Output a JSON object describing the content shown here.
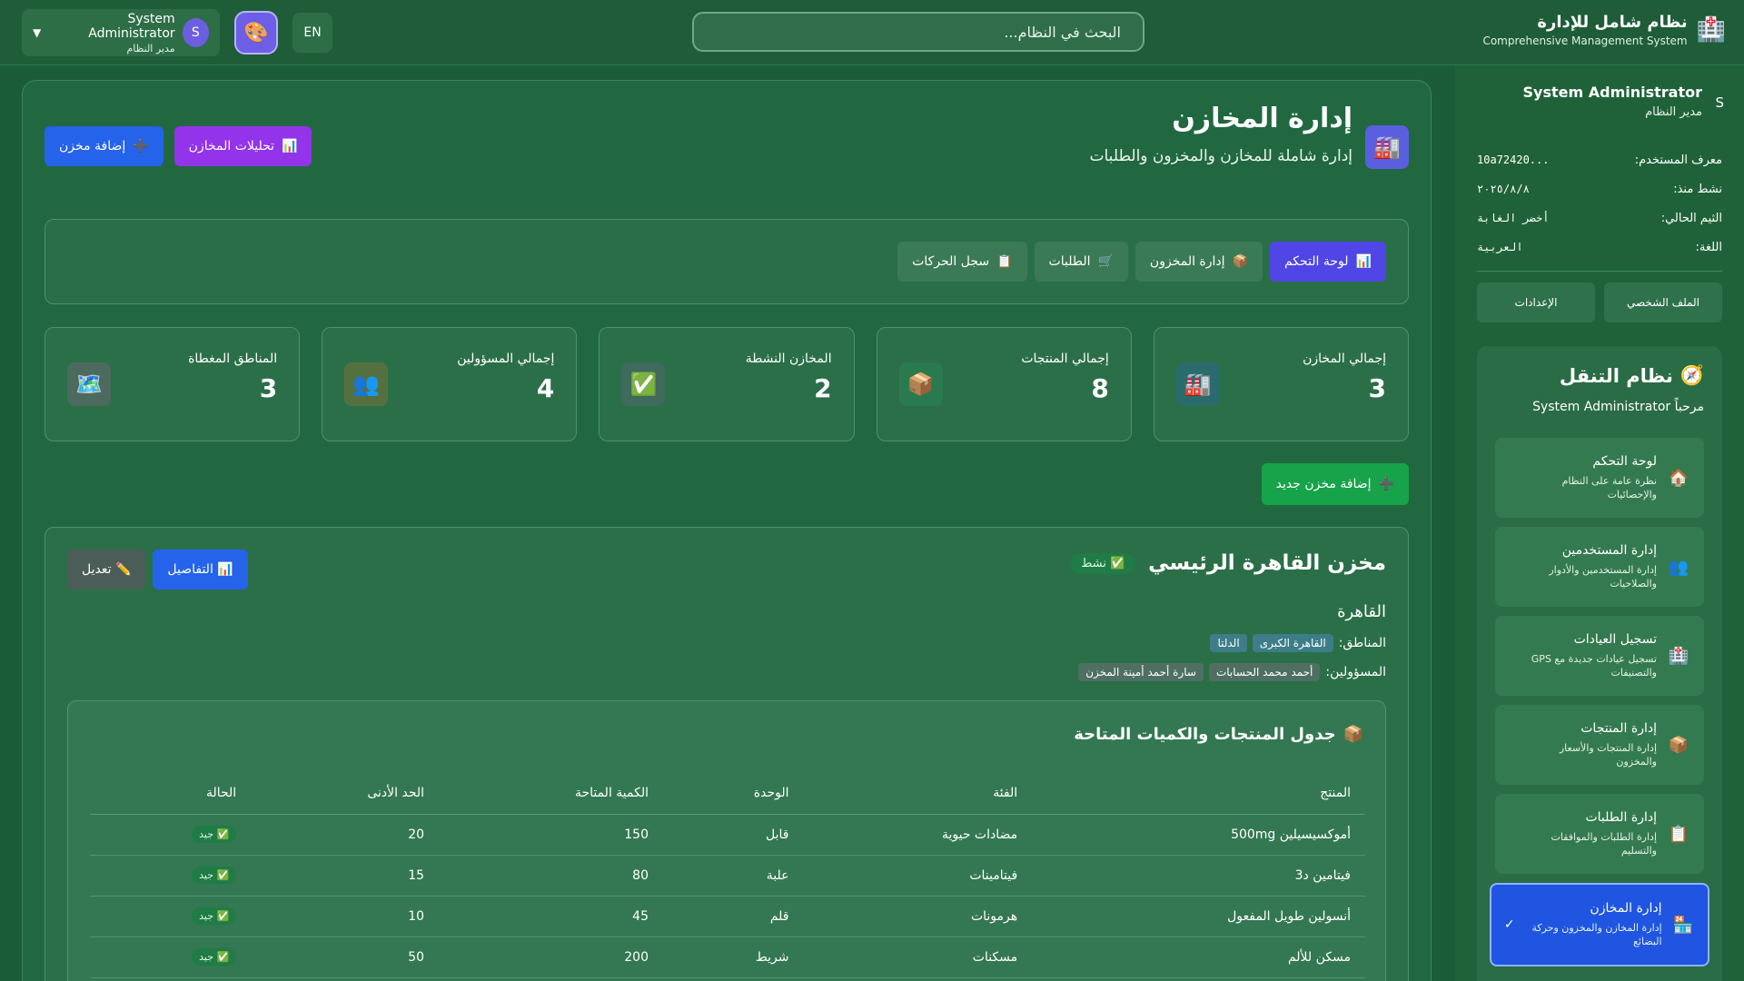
{
  "header": {
    "brand_icon": "🏥",
    "brand_ar": "نظام شامل للإدارة",
    "brand_en": "Comprehensive Management System",
    "search_placeholder": "البحث في النظام...",
    "lang": "EN",
    "theme_icon": "🎨",
    "user_initial": "S",
    "user_name": "System Administrator",
    "user_role": "مدير النظام",
    "caret": "▼"
  },
  "sidebar": {
    "initial": "S",
    "name": "System Administrator",
    "role": "مدير النظام",
    "info": [
      {
        "label": "معرف المستخدم:",
        "value": "...10a72420"
      },
      {
        "label": "نشط منذ:",
        "value": "٢٠٢٥/٨/٨"
      },
      {
        "label": "الثيم الحالي:",
        "value": "أخضر الغابة"
      },
      {
        "label": "اللغة:",
        "value": "العربية"
      }
    ],
    "profile_btn": "الملف الشخصي",
    "settings_btn": "الإعدادات",
    "nav_icon": "🧭",
    "nav_title": "نظام التنقل",
    "welcome": "مرحباً System Administrator",
    "items": [
      {
        "icon": "🏠",
        "title": "لوحة التحكم",
        "desc": "نظرة عامة على النظام والإحصائيات"
      },
      {
        "icon": "👥",
        "title": "إدارة المستخدمين",
        "desc": "إدارة المستخدمين والأدوار والصلاحيات"
      },
      {
        "icon": "🏥",
        "title": "تسجيل العيادات",
        "desc": "تسجيل عيادات جديدة مع GPS والتصنيفات"
      },
      {
        "icon": "📦",
        "title": "إدارة المنتجات",
        "desc": "إدارة المنتجات والأسعار والمخزون"
      },
      {
        "icon": "📋",
        "title": "إدارة الطلبات",
        "desc": "إدارة الطلبات والموافقات والتسليم"
      },
      {
        "icon": "🏪",
        "title": "إدارة المخازن",
        "desc": "إدارة المخازن والمخزون وحركة البضائع",
        "check": "✓"
      }
    ]
  },
  "page": {
    "icon": "🏭",
    "title": "إدارة المخازن",
    "subtitle": "إدارة شاملة للمخازن والمخزون والطلبات",
    "analytics_btn": "تحليلات المخازن",
    "analytics_icon": "📊",
    "add_btn": "إضافة مخزن",
    "add_icon": "➕",
    "tabs": [
      {
        "icon": "📊",
        "label": "لوحة التحكم"
      },
      {
        "icon": "📦",
        "label": "إدارة المخزون"
      },
      {
        "icon": "🛒",
        "label": "الطلبات"
      },
      {
        "icon": "📋",
        "label": "سجل الحركات"
      }
    ],
    "stats": [
      {
        "label": "إجمالي المخازن",
        "value": "3",
        "icon": "🏭",
        "color": "#2a6b6e"
      },
      {
        "label": "إجمالي المنتجات",
        "value": "8",
        "icon": "📦",
        "color": "#2a7a4f"
      },
      {
        "label": "المخازن النشطة",
        "value": "2",
        "icon": "✅",
        "color": "#3f6a5c"
      },
      {
        "label": "إجمالي المسؤولين",
        "value": "4",
        "icon": "👥",
        "color": "#55703f"
      },
      {
        "label": "المناطق المغطاة",
        "value": "3",
        "icon": "🗺️",
        "color": "#4d6a5e"
      }
    ],
    "add_new_btn": "إضافة مخزن جديد",
    "add_new_icon": "➕"
  },
  "warehouse": {
    "name": "مخزن القاهرة الرئيسي",
    "status": "✅ نشط",
    "details_btn": "📊 التفاصيل",
    "edit_btn": "✏️ تعديل",
    "city": "القاهرة",
    "regions_label": "المناطق:",
    "regions": [
      "القاهرة الكبرى",
      "الدلتا"
    ],
    "managers_label": "المسؤولين:",
    "managers": [
      "أحمد محمد الحسابات",
      "سارة أحمد أمينة المخزن"
    ],
    "products_icon": "📦",
    "products_title": "جدول المنتجات والكميات المتاحة",
    "columns": [
      "المنتج",
      "الفئة",
      "الوحدة",
      "الكمية المتاحة",
      "الحد الأدنى",
      "الحالة"
    ],
    "rows": [
      {
        "product": "أموكسيسيلين 500mg",
        "category": "مضادات حيوية",
        "unit": "قابل",
        "qty": "150",
        "min": "20",
        "status": "✅ جيد"
      },
      {
        "product": "فيتامين د3",
        "category": "فيتامينات",
        "unit": "علبة",
        "qty": "80",
        "min": "15",
        "status": "✅ جيد"
      },
      {
        "product": "أنسولين طويل المفعول",
        "category": "هرمونات",
        "unit": "قلم",
        "qty": "45",
        "min": "10",
        "status": "✅ جيد"
      },
      {
        "product": "مسكن للألم",
        "category": "مسكنات",
        "unit": "شريط",
        "qty": "200",
        "min": "50",
        "status": "✅ جيد"
      }
    ]
  }
}
